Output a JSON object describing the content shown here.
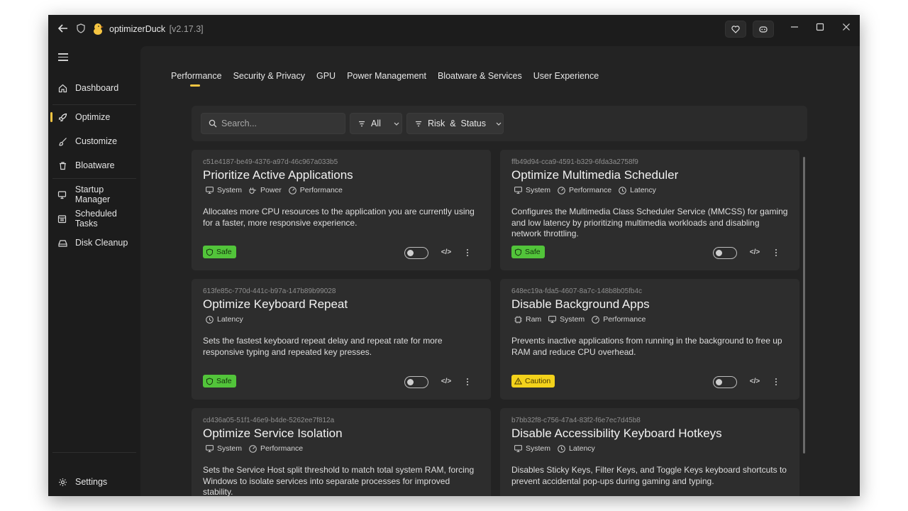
{
  "titlebar": {
    "app_name": "optimizerDuck",
    "version": "[v2.17.3]"
  },
  "sidebar": {
    "items": [
      {
        "label": "Dashboard",
        "icon": "home-icon"
      },
      {
        "label": "Optimize",
        "icon": "rocket-icon",
        "active": true
      },
      {
        "label": "Customize",
        "icon": "brush-icon"
      },
      {
        "label": "Bloatware",
        "icon": "trash-icon"
      },
      {
        "label": "Startup Manager",
        "icon": "monitor-icon"
      },
      {
        "label": "Scheduled Tasks",
        "icon": "calendar-icon"
      },
      {
        "label": "Disk Cleanup",
        "icon": "drive-icon"
      }
    ],
    "settings_label": "Settings"
  },
  "tabs": [
    "Performance",
    "Security & Privacy",
    "GPU",
    "Power Management",
    "Bloatware & Services",
    "User Experience"
  ],
  "filters": {
    "search_placeholder": "Search...",
    "all_label": "All",
    "risk_label": "Risk  &  Status"
  },
  "cards": [
    {
      "uid": "c51e4187-be49-4376-a97d-46c967a033b5",
      "title": "Prioritize Active Applications",
      "tags": [
        "System",
        "Power",
        "Performance"
      ],
      "description": "Allocates more CPU resources to the application you are currently using for a faster, more responsive experience.",
      "risk": "Safe"
    },
    {
      "uid": "ffb49d94-cca9-4591-b329-6fda3a2758f9",
      "title": "Optimize Multimedia Scheduler",
      "tags": [
        "System",
        "Performance",
        "Latency"
      ],
      "description": "Configures the Multimedia Class Scheduler Service (MMCSS) for gaming and low latency by prioritizing multimedia workloads and disabling network throttling.",
      "risk": "Safe"
    },
    {
      "uid": "613fe85c-770d-441c-b97a-147b89b99028",
      "title": "Optimize Keyboard Repeat",
      "tags": [
        "Latency"
      ],
      "description": "Sets the fastest keyboard repeat delay and repeat rate for more responsive typing and repeated key presses.",
      "risk": "Safe"
    },
    {
      "uid": "648ec19a-fda5-4607-8a7c-148b8b05fb4c",
      "title": "Disable Background Apps",
      "tags": [
        "Ram",
        "System",
        "Performance"
      ],
      "description": "Prevents inactive applications from running in the background to free up RAM and reduce CPU overhead.",
      "risk": "Caution"
    },
    {
      "uid": "cd436a05-51f1-46e9-b4de-5262ee7f812a",
      "title": "Optimize Service Isolation",
      "tags": [
        "System",
        "Performance"
      ],
      "description": "Sets the Service Host split threshold to match total system RAM, forcing Windows to isolate services into separate processes for improved stability.",
      "risk": ""
    },
    {
      "uid": "b7bb32f8-c756-47a4-83f2-f6e7ec7d45b8",
      "title": "Disable Accessibility Keyboard Hotkeys",
      "tags": [
        "System",
        "Latency"
      ],
      "description": "Disables Sticky Keys, Filter Keys, and Toggle Keys keyboard shortcuts to prevent accidental pop-ups during gaming and typing.",
      "risk": ""
    }
  ],
  "colors": {
    "accent": "#f5c542",
    "safe": "#52c43a",
    "caution": "#f3d21b"
  }
}
